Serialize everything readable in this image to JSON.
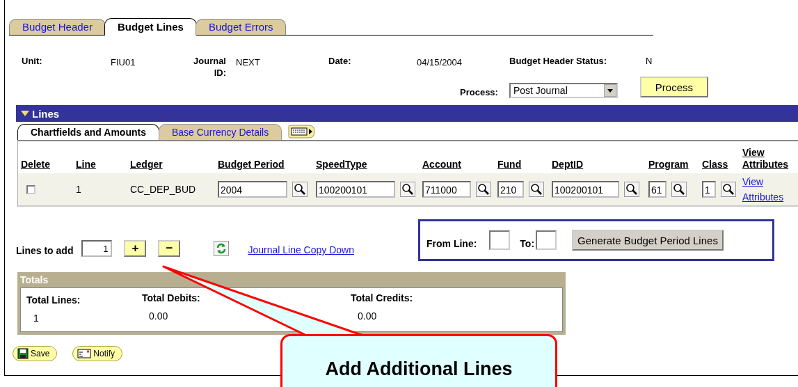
{
  "tabs": [
    {
      "label": "Budget Header",
      "selected": false
    },
    {
      "label": "Budget Lines",
      "selected": true
    },
    {
      "label": "Budget Errors",
      "selected": false
    }
  ],
  "header": {
    "unit_label": "Unit:",
    "unit": "FIU01",
    "journal_label": "Journal ID:",
    "journal_id": "NEXT",
    "date_label": "Date:",
    "date": "04/15/2004",
    "status_label": "Budget Header Status:",
    "status": "N",
    "process_label": "Process:",
    "process_value": "Post Journal",
    "process_button": "Process"
  },
  "lines": {
    "title": "Lines",
    "expanded": true,
    "subtabs": [
      {
        "label": "Chartfields and Amounts",
        "selected": true
      },
      {
        "label": "Base Currency Details",
        "selected": false
      }
    ],
    "columns": [
      "Delete",
      "Line",
      "Ledger",
      "Budget Period",
      "SpeedType",
      "Account",
      "Fund",
      "DeptID",
      "Program",
      "Class",
      "View Attributes"
    ],
    "rows": [
      {
        "delete": false,
        "line": "1",
        "ledger": "CC_DEP_BUD",
        "budget_period": "2004",
        "speedtype": "100200101",
        "account": "711000",
        "fund": "210",
        "deptid": "100200101",
        "program": "61",
        "class": "1",
        "link": "View Attributes"
      }
    ]
  },
  "add_lines": {
    "label": "Lines to add",
    "value": "1",
    "add": "+",
    "remove": "−",
    "copy_down": "Journal Line Copy Down"
  },
  "generate": {
    "from_label": "From Line:",
    "to_label": "To:",
    "button": "Generate Budget Period Lines"
  },
  "totals": {
    "title": "Totals",
    "items": [
      {
        "label": "Total Lines:",
        "value": "1"
      },
      {
        "label": "Total Debits:",
        "value": "0.00"
      },
      {
        "label": "Total Credits:",
        "value": "0.00"
      }
    ]
  },
  "footer_buttons": [
    {
      "kind": "save",
      "label": "Save"
    },
    {
      "kind": "notify",
      "label": "Notify"
    }
  ],
  "callout": {
    "text": "Add Additional Lines"
  }
}
